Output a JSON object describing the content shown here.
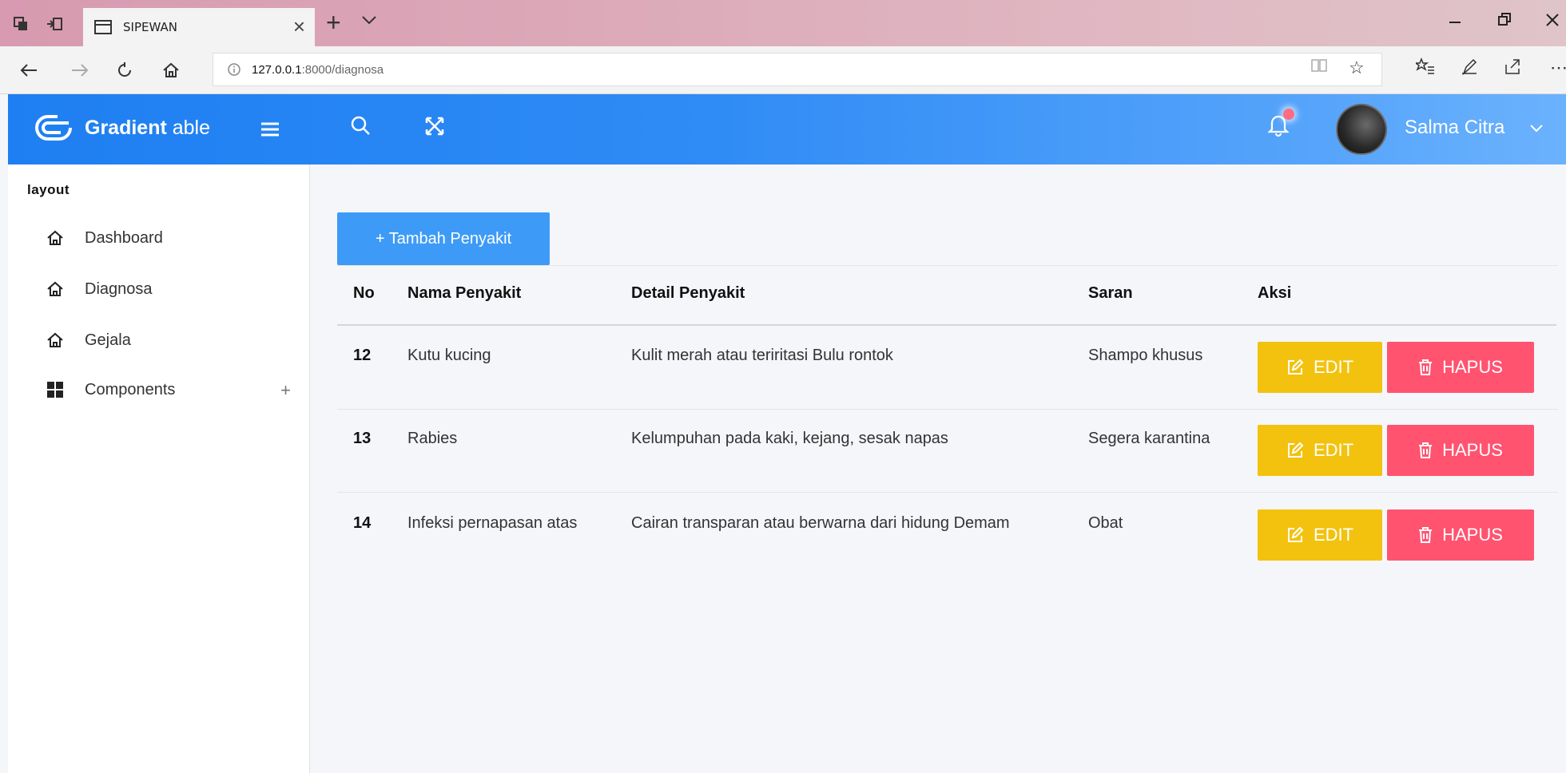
{
  "browser": {
    "tab_title": "SIPEWAN",
    "url_host": "127.0.0.1",
    "url_path": ":8000/diagnosa"
  },
  "header": {
    "brand_bold": "Gradient",
    "brand_light": "able",
    "user_name": "Salma Citra"
  },
  "sidebar": {
    "caption": "layout",
    "items": [
      {
        "label": "Dashboard",
        "icon": "home-icon"
      },
      {
        "label": "Diagnosa",
        "icon": "home-icon"
      },
      {
        "label": "Gejala",
        "icon": "home-icon"
      },
      {
        "label": "Components",
        "icon": "grid-icon"
      }
    ],
    "components_expand": "+"
  },
  "main": {
    "add_button": "+ Tambah Penyakit",
    "columns": [
      "No",
      "Nama Penyakit",
      "Detail Penyakit",
      "Saran",
      "Aksi"
    ],
    "rows": [
      {
        "no": "12",
        "nama": "Kutu kucing",
        "detail": "Kulit merah atau teriritasi Bulu rontok",
        "saran": "Shampo khusus"
      },
      {
        "no": "13",
        "nama": "Rabies",
        "detail": "Kelumpuhan pada kaki, kejang, sesak napas",
        "saran": "Segera karantina"
      },
      {
        "no": "14",
        "nama": "Infeksi pernapasan atas",
        "detail": "Cairan transparan atau berwarna dari hidung Demam",
        "saran": "Obat"
      }
    ],
    "edit_label": "EDIT",
    "delete_label": "HAPUS"
  },
  "colors": {
    "header_start": "#1e7ff2",
    "header_end": "#6bb2fd",
    "primary": "#3d9bf7",
    "warning": "#f2c20f",
    "danger": "#ff5370"
  }
}
